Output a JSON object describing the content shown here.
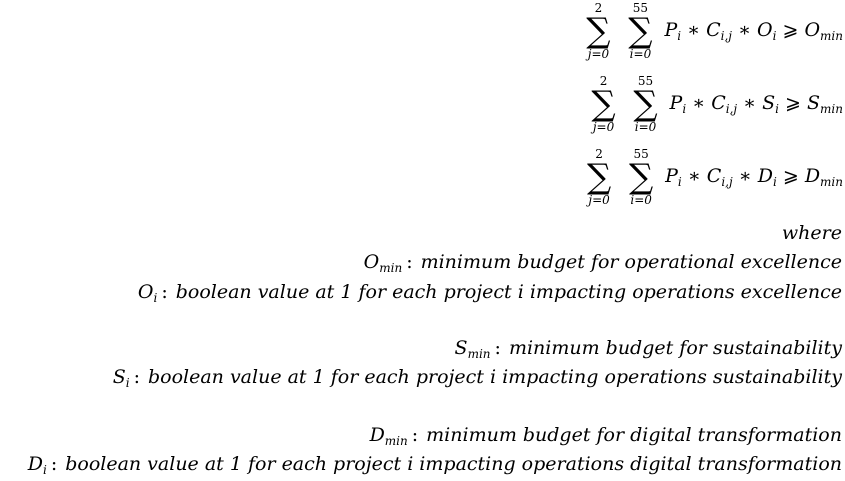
{
  "equations": [
    {
      "outer_sum": {
        "lower": "j=0",
        "upper": "2"
      },
      "inner_sum": {
        "lower": "i=0",
        "upper": "55"
      },
      "terms": "P",
      "sub_i": "i",
      "c": "C",
      "c_sub": "i,j",
      "var": "O",
      "var_sub": "i",
      "rel": "⩾",
      "rhs": "O",
      "rhs_sub": "min",
      "op": "∗"
    },
    {
      "outer_sum": {
        "lower": "j=0",
        "upper": "2"
      },
      "inner_sum": {
        "lower": "i=0",
        "upper": "55"
      },
      "terms": "P",
      "sub_i": "i",
      "c": "C",
      "c_sub": "i,j",
      "var": "S",
      "var_sub": "i",
      "rel": "⩾",
      "rhs": "S",
      "rhs_sub": "min",
      "op": "∗"
    },
    {
      "outer_sum": {
        "lower": "j=0",
        "upper": "2"
      },
      "inner_sum": {
        "lower": "i=0",
        "upper": "55"
      },
      "terms": "P",
      "sub_i": "i",
      "c": "C",
      "c_sub": "i,j",
      "var": "D",
      "var_sub": "i",
      "rel": "⩾",
      "rhs": "D",
      "rhs_sub": "min",
      "op": "∗"
    }
  ],
  "where": "where",
  "definitions": [
    {
      "sym": "O",
      "sub": "min",
      "text": "minimum budget for operational excellence"
    },
    {
      "sym": "O",
      "sub": "i",
      "text": "boolean value at 1 for each project i impacting operations excellence"
    },
    {
      "sym": "S",
      "sub": "min",
      "text": "minimum budget for sustainability"
    },
    {
      "sym": "S",
      "sub": "i",
      "text": "boolean value at 1 for each project i impacting operations sustainability"
    },
    {
      "sym": "D",
      "sub": "min",
      "text": "minimum budget for digital transformation"
    },
    {
      "sym": "D",
      "sub": "i",
      "text": "boolean value at 1 for each project i impacting operations digital transformation"
    }
  ],
  "colon": ":"
}
